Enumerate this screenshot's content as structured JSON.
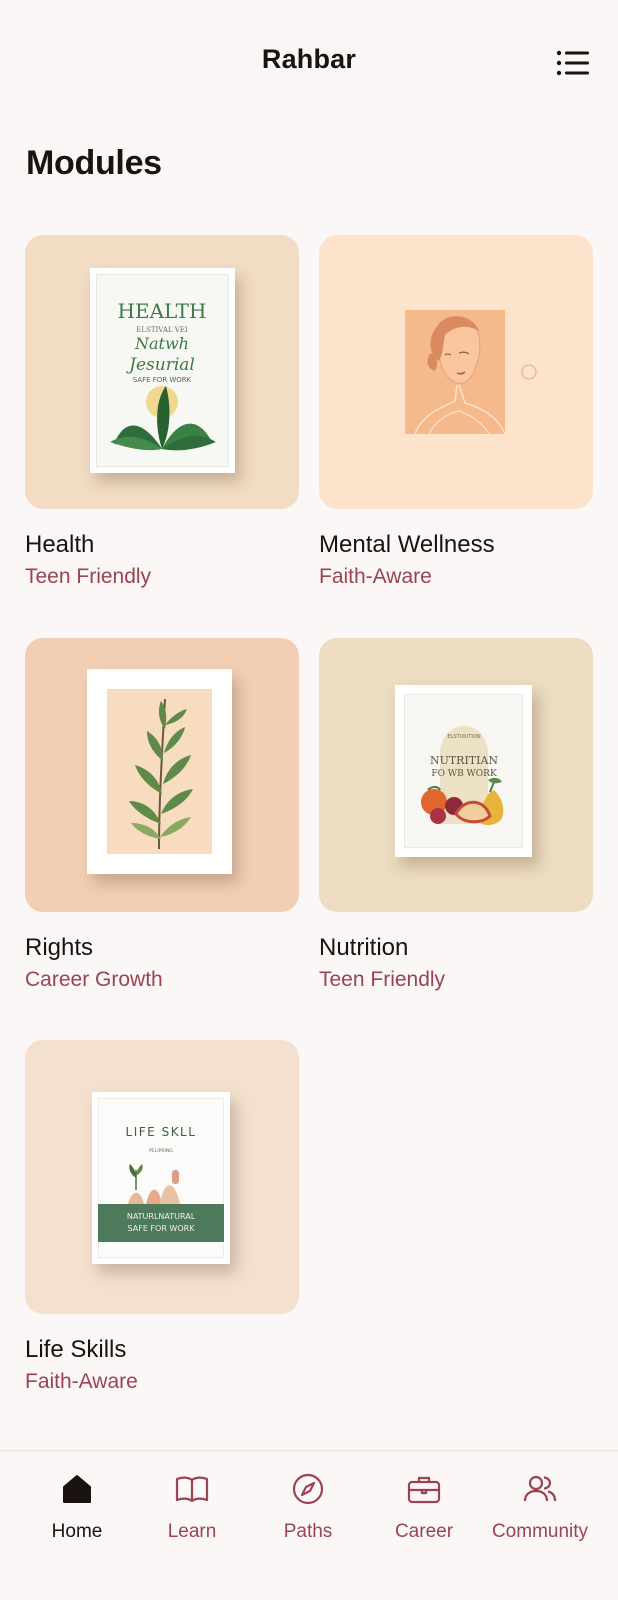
{
  "header": {
    "title": "Rahbar",
    "menu_icon": "list-menu-icon"
  },
  "section": {
    "title": "Modules"
  },
  "modules": [
    {
      "title": "Health",
      "tag": "Teen Friendly",
      "bg": "#f2dcc4",
      "poster": {
        "heading": "HEALTH",
        "line1": "ELSTIVAL VEI",
        "line2": "Natwh",
        "line3": "Jesurial",
        "line4": "SAFE FOR WORK"
      }
    },
    {
      "title": "Mental Wellness",
      "tag": "Faith-Aware",
      "bg": "#fde3cc"
    },
    {
      "title": "Rights",
      "tag": "Career Growth",
      "bg": "#f2cfb4"
    },
    {
      "title": "Nutrition",
      "tag": "Teen Friendly",
      "bg": "#ecdcc1",
      "poster": {
        "line0": "ELSTUIUTION",
        "heading": "NUTRITIAN",
        "line1": "FO WB WORK"
      }
    },
    {
      "title": "Life Skills",
      "tag": "Faith-Aware",
      "bg": "#f4e0cf",
      "poster": {
        "heading": "LIFE SKLL",
        "line1": "PELIPRING",
        "line2": "NATURLNATURAL",
        "line3": "SAFE FOR WORK"
      }
    }
  ],
  "nav": [
    {
      "label": "Home",
      "icon": "home-icon",
      "active": true
    },
    {
      "label": "Learn",
      "icon": "book-icon",
      "active": false
    },
    {
      "label": "Paths",
      "icon": "compass-icon",
      "active": false
    },
    {
      "label": "Career",
      "icon": "briefcase-icon",
      "active": false
    },
    {
      "label": "Community",
      "icon": "users-icon",
      "active": false
    }
  ],
  "colors": {
    "accent": "#9a4452",
    "text": "#1b1212",
    "background": "#fbf7f6"
  }
}
